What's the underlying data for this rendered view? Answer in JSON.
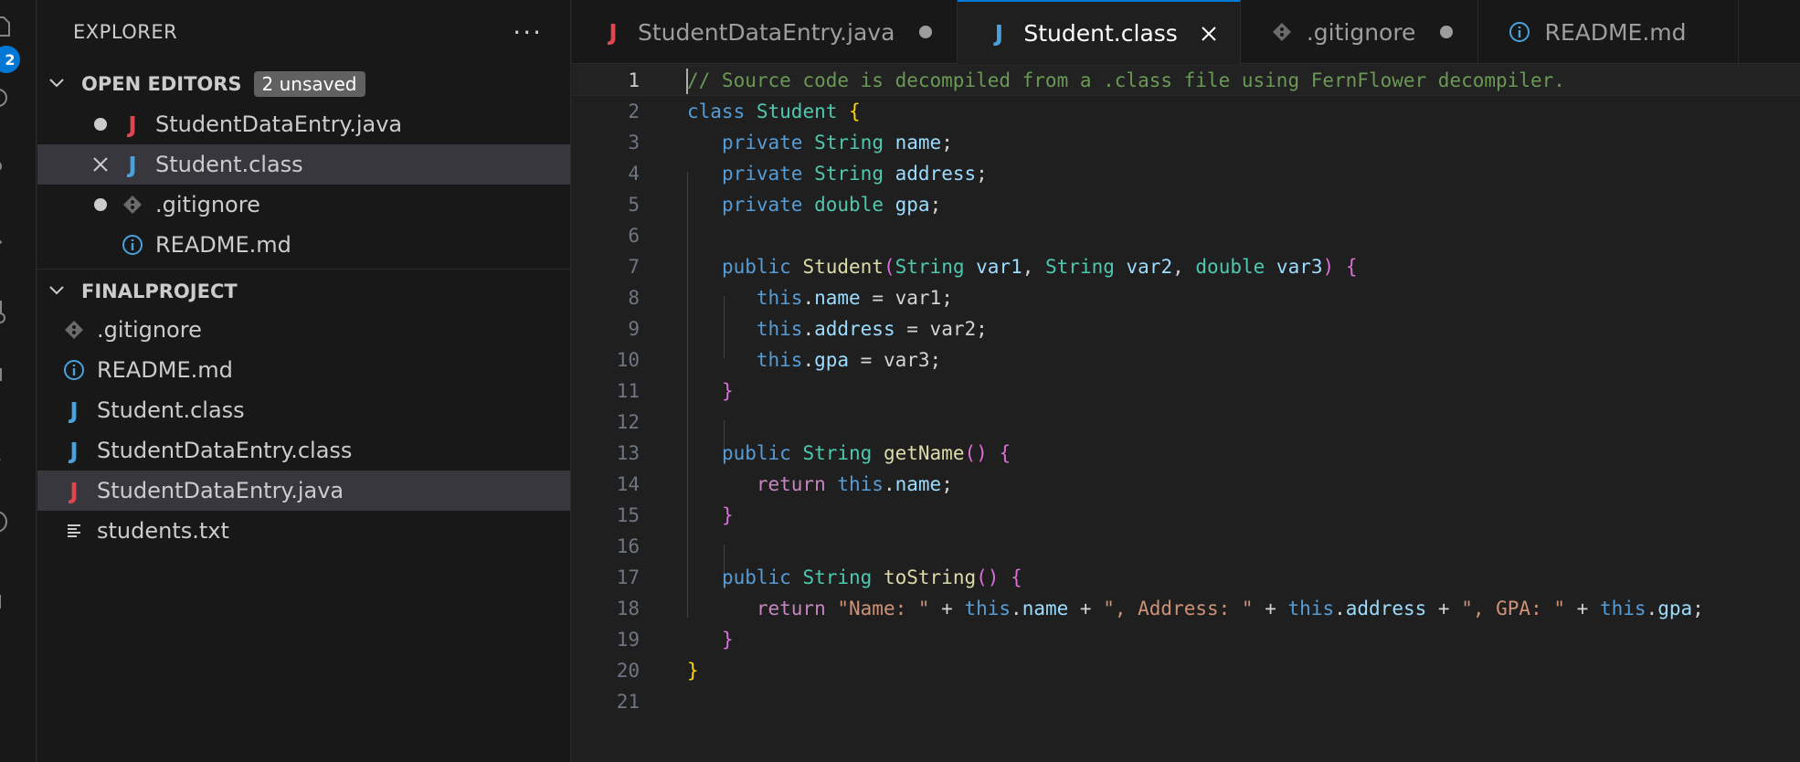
{
  "activity_bar": {
    "explorer_badge": "2"
  },
  "sidebar": {
    "title": "EXPLORER",
    "more_label": "···",
    "open_editors": {
      "label": "OPEN EDITORS",
      "badge": "2 unsaved",
      "items": [
        {
          "name": "StudentDataEntry.java",
          "status": "unsaved",
          "icon": "java-icon",
          "color": "#e0464f"
        },
        {
          "name": "Student.class",
          "status": "close",
          "icon": "java-class-icon",
          "color": "#4aa2dc"
        },
        {
          "name": ".gitignore",
          "status": "unsaved",
          "icon": "git-icon"
        },
        {
          "name": "README.md",
          "status": "none",
          "icon": "info-icon"
        }
      ]
    },
    "project": {
      "label": "FINALPROJECT",
      "items": [
        {
          "name": ".gitignore",
          "icon": "git-icon"
        },
        {
          "name": "README.md",
          "icon": "info-icon"
        },
        {
          "name": "Student.class",
          "icon": "java-class-icon"
        },
        {
          "name": "StudentDataEntry.class",
          "icon": "java-class-icon"
        },
        {
          "name": "StudentDataEntry.java",
          "icon": "java-icon"
        },
        {
          "name": "students.txt",
          "icon": "text-file-icon"
        }
      ]
    }
  },
  "tabs": [
    {
      "label": "StudentDataEntry.java",
      "state": "unsaved"
    },
    {
      "label": "Student.class",
      "state": "active"
    },
    {
      "label": ".gitignore",
      "state": "unsaved"
    },
    {
      "label": "README.md",
      "state": "none"
    }
  ],
  "editor": {
    "line_numbers": [
      "1",
      "2",
      "3",
      "4",
      "5",
      "6",
      "7",
      "8",
      "9",
      "10",
      "11",
      "12",
      "13",
      "14",
      "15",
      "16",
      "17",
      "18",
      "19",
      "20",
      "21"
    ],
    "current_line": "1",
    "code": {
      "l1": "// Source code is decompiled from a .class file using FernFlower decompiler.",
      "class_kw": "class",
      "class_name": "Student",
      "private_kw": "private",
      "public_kw": "public",
      "string_type": "String",
      "double_type": "double",
      "this_kw": "this",
      "return_kw": "return",
      "f_name": "name",
      "f_address": "address",
      "f_gpa": "gpa",
      "var1": "var1",
      "var2": "var2",
      "var3": "var3",
      "m_getName": "getName",
      "m_toString": "toString",
      "s_name": "\"Name: \"",
      "s_address": "\", Address: \"",
      "s_gpa": "\", GPA: \""
    }
  }
}
